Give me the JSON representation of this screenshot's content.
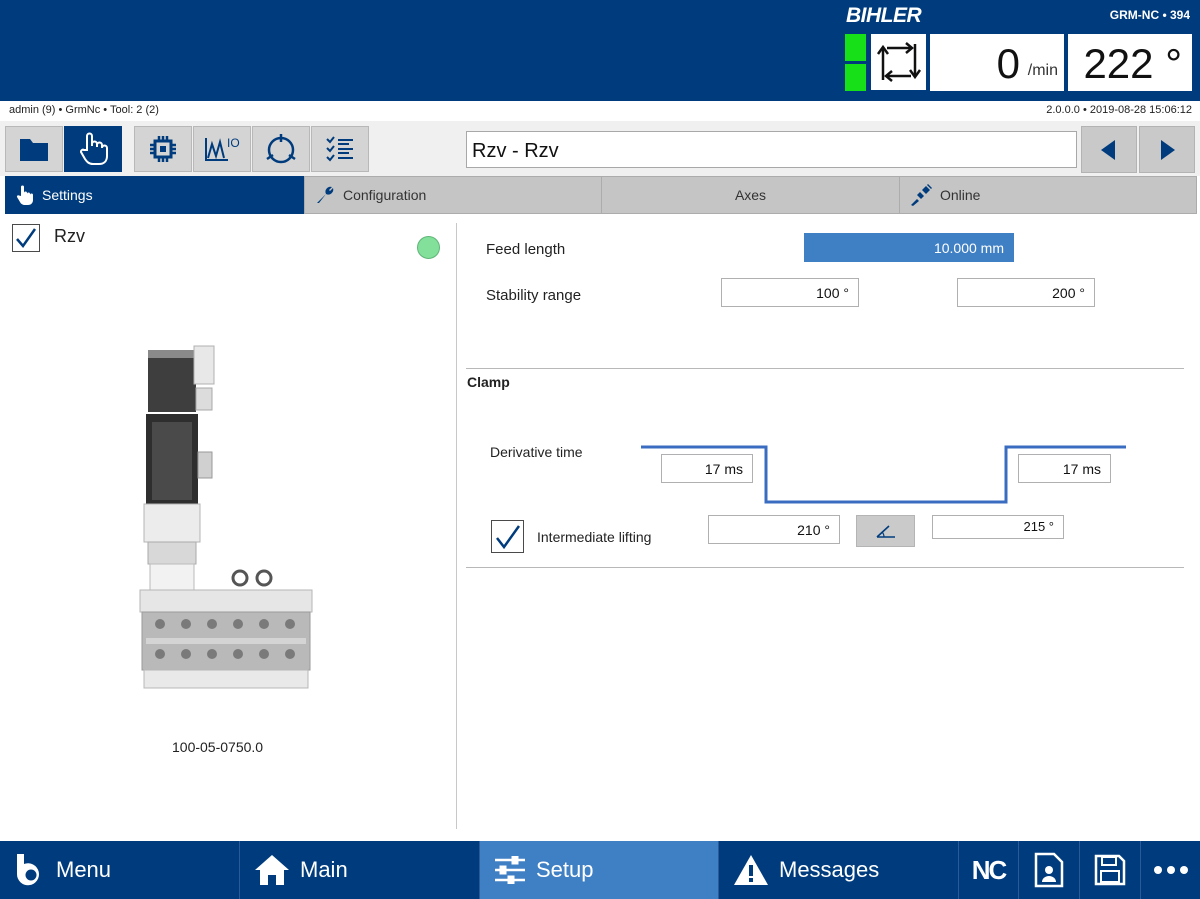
{
  "header": {
    "brand": "BIHLER",
    "machine_id": "GRM-NC • 394",
    "speed_value": "0",
    "speed_unit": "/min",
    "angle_value": "222 °"
  },
  "status": {
    "left": "admin (9) • GrmNc • Tool: 2 (2)",
    "right": "2.0.0.0 • 2019-08-28 15:06:12"
  },
  "toolbar": {
    "title": "Rzv - Rzv"
  },
  "tabs": [
    {
      "label": "Settings",
      "icon": "hand-pointer-icon"
    },
    {
      "label": "Configuration",
      "icon": "wrench-icon"
    },
    {
      "label": "Axes"
    },
    {
      "label": "Online",
      "icon": "connect-plug-icon"
    }
  ],
  "left_panel": {
    "module_name": "Rzv",
    "module_enabled": true,
    "device_caption": "100-05-0750.0"
  },
  "settings": {
    "feed_length_label": "Feed length",
    "feed_length_value": "10.000 mm",
    "stability_range_label": "Stability range",
    "stability_from": "100 °",
    "stability_to": "200 °"
  },
  "clamp": {
    "title": "Clamp",
    "derivative_time_label": "Derivative time",
    "derivative_time_left": "17 ms",
    "derivative_time_right": "17 ms",
    "intermediate_lifting_label": "Intermediate lifting",
    "intermediate_lifting_checked": true,
    "lift_from": "210 °",
    "lift_to": "215 °"
  },
  "bottom_nav": [
    {
      "label": "Menu",
      "icon": "bihler-b-icon"
    },
    {
      "label": "Main",
      "icon": "home-icon"
    },
    {
      "label": "Setup",
      "icon": "sliders-icon",
      "active": true
    },
    {
      "label": "Messages",
      "icon": "warning-icon"
    }
  ],
  "bottom_icons": {
    "nc_label": "NC"
  },
  "colors": {
    "primary": "#003c7d",
    "accent": "#3f7fc4",
    "indicator": "#18e018",
    "status_dot": "#82e09a"
  }
}
